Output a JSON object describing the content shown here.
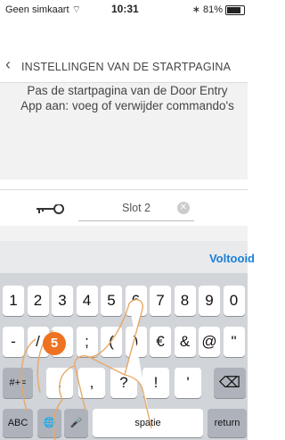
{
  "status": {
    "carrier": "Geen simkaart",
    "time": "10:31",
    "battery": "81%",
    "battery_level": 0.81
  },
  "nav": {
    "title": "INSTELLINGEN VAN DE STARTPAGINA"
  },
  "description": "Pas de startpagina van de Door Entry App aan: voeg of verwijder commando's",
  "entry": {
    "value": "Slot 2"
  },
  "keyboard": {
    "done_label": "Voltooid",
    "row1": [
      "1",
      "2",
      "3",
      "4",
      "5",
      "6",
      "7",
      "8",
      "9",
      "0"
    ],
    "row2": [
      "-",
      "/",
      ":",
      ";",
      "(",
      ")",
      "€",
      "&",
      "@",
      "\""
    ],
    "row3": [
      ".",
      ",",
      "?",
      "!",
      "'"
    ],
    "mode_key": "#+=",
    "abc_key": "ABC",
    "space_label": "spatie",
    "return_label": "return"
  },
  "step_badge": "5",
  "colors": {
    "accent": "#1a7fd8",
    "badge": "#ee7222"
  }
}
